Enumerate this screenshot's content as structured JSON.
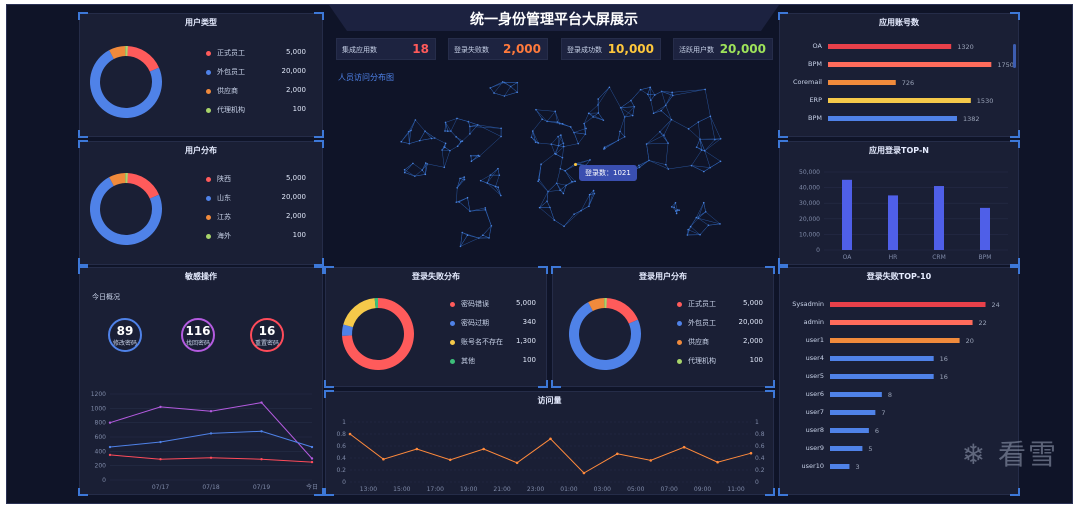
{
  "title": "统一身份管理平台大屏展示",
  "watermark": {
    "icon": "snowflake-icon",
    "text": "看雪"
  },
  "stats": [
    {
      "label": "集成应用数",
      "value": "18",
      "color": "#ff5a5a"
    },
    {
      "label": "登录失败数",
      "value": "2,000",
      "color": "#ff7a3c"
    },
    {
      "label": "登录成功数",
      "value": "10,000",
      "color": "#ffc83c"
    },
    {
      "label": "活跃用户数",
      "value": "20,000",
      "color": "#9ee35a"
    }
  ],
  "map": {
    "label": "人员访问分布图",
    "tooltip": "登录数：1021"
  },
  "user_type": {
    "title": "用户类型",
    "items": [
      {
        "name": "正式员工",
        "value": 5000,
        "value_text": "5,000",
        "color": "#ff5b5b"
      },
      {
        "name": "外包员工",
        "value": 20000,
        "value_text": "20,000",
        "color": "#4f82e8"
      },
      {
        "name": "供应商",
        "value": 2000,
        "value_text": "2,000",
        "color": "#f08a3c"
      },
      {
        "name": "代理机构",
        "value": 100,
        "value_text": "100",
        "color": "#a8d46a"
      }
    ]
  },
  "user_dist": {
    "title": "用户分布",
    "items": [
      {
        "name": "陕西",
        "value": 5000,
        "value_text": "5,000",
        "color": "#ff5b5b"
      },
      {
        "name": "山东",
        "value": 20000,
        "value_text": "20,000",
        "color": "#4f82e8"
      },
      {
        "name": "江苏",
        "value": 2000,
        "value_text": "2,000",
        "color": "#f08a3c"
      },
      {
        "name": "海外",
        "value": 100,
        "value_text": "100",
        "color": "#a8d46a"
      }
    ]
  },
  "sensitive": {
    "title": "敏感操作",
    "subtitle": "今日概况",
    "circles": [
      {
        "value": "89",
        "label": "修改密码",
        "color": "#4f82e8"
      },
      {
        "value": "116",
        "label": "找回密码",
        "color": "#b45be0"
      },
      {
        "value": "16",
        "label": "重置密码",
        "color": "#ff4b5a"
      }
    ]
  },
  "login_fail_dist": {
    "title": "登录失败分布",
    "items": [
      {
        "name": "密码错误",
        "value": 5000,
        "value_text": "5,000",
        "color": "#ff5b5b"
      },
      {
        "name": "密码过期",
        "value": 340,
        "value_text": "340",
        "color": "#4f82e8"
      },
      {
        "name": "账号名不存在",
        "value": 1300,
        "value_text": "1,300",
        "color": "#f5c94a"
      },
      {
        "name": "其他",
        "value": 100,
        "value_text": "100",
        "color": "#3dbf7a"
      }
    ]
  },
  "login_user_dist": {
    "title": "登录用户分布",
    "items": [
      {
        "name": "正式员工",
        "value": 5000,
        "value_text": "5,000",
        "color": "#ff5b5b"
      },
      {
        "name": "外包员工",
        "value": 20000,
        "value_text": "20,000",
        "color": "#4f82e8"
      },
      {
        "name": "供应商",
        "value": 2000,
        "value_text": "2,000",
        "color": "#f08a3c"
      },
      {
        "name": "代理机构",
        "value": 100,
        "value_text": "100",
        "color": "#a8d46a"
      }
    ]
  },
  "visits_title": "访问量",
  "app_accounts_title": "应用账号数",
  "app_login_title": "应用登录TOP-N",
  "login_fail_top_title": "登录失败TOP-10",
  "chart_data": [
    {
      "type": "line",
      "categories": [
        "07/17",
        "07/18",
        "07/19",
        "今日"
      ],
      "ylim": [
        0,
        1200
      ],
      "yticks": [
        "1200",
        "1000",
        "800",
        "600",
        "400",
        "200",
        "0"
      ],
      "series": [
        {
          "color": "#b45be0",
          "values": [
            800,
            1020,
            960,
            1080,
            300
          ]
        },
        {
          "color": "#4f82e8",
          "values": [
            460,
            530,
            650,
            680,
            460
          ]
        },
        {
          "color": "#ff4b5a",
          "values": [
            350,
            290,
            310,
            290,
            250
          ]
        }
      ]
    },
    {
      "type": "line",
      "categories": [
        "13:00",
        "15:00",
        "17:00",
        "19:00",
        "21:00",
        "23:00",
        "01:00",
        "03:00",
        "05:00",
        "07:00",
        "09:00",
        "11:00"
      ],
      "ylim": [
        0,
        1
      ],
      "yticks": [
        "1",
        "0.8",
        "0.6",
        "0.4",
        "0.2",
        "0"
      ],
      "series": [
        {
          "color": "#ff8a3c",
          "values": [
            0.8,
            0.38,
            0.55,
            0.37,
            0.55,
            0.32,
            0.72,
            0.15,
            0.47,
            0.36,
            0.58,
            0.33,
            0.48
          ]
        }
      ]
    },
    {
      "type": "bar",
      "orientation": "horizontal",
      "categories": [
        "OA",
        "BPM",
        "Coremail",
        "ERP",
        "BPM"
      ],
      "values": [
        1320,
        1750,
        726,
        1530,
        1382
      ],
      "value_labels": [
        "1320",
        "1750",
        "726",
        "1530",
        "1382"
      ],
      "colors": [
        "#e8404a",
        "#ff6b5b",
        "#f08a3c",
        "#f5c94a",
        "#4f82e8"
      ],
      "xlim": [
        0,
        1800
      ]
    },
    {
      "type": "bar",
      "categories": [
        "OA",
        "HR",
        "CRM",
        "BPM"
      ],
      "values": [
        45000,
        35000,
        41000,
        27000
      ],
      "ylim": [
        0,
        50000
      ],
      "yticks": [
        "50,000",
        "40,000",
        "30,000",
        "20,000",
        "10,000",
        "0"
      ],
      "color": "#4f5fe8"
    },
    {
      "type": "bar",
      "orientation": "horizontal",
      "categories": [
        "Sysadmin",
        "admin",
        "user1",
        "user4",
        "user5",
        "user6",
        "user7",
        "user8",
        "user9",
        "user10"
      ],
      "values": [
        24,
        22,
        20,
        16,
        16,
        8,
        7,
        6,
        5,
        3
      ],
      "value_labels": [
        "24",
        "22",
        "20",
        "16",
        "16",
        "8",
        "7",
        "6",
        "5",
        "3"
      ],
      "colors": [
        "#e8404a",
        "#ff6b5b",
        "#f08a3c",
        "#4f82e8",
        "#4f82e8",
        "#4f82e8",
        "#4f82e8",
        "#4f82e8",
        "#4f82e8",
        "#4f82e8"
      ],
      "xlim": [
        0,
        25
      ]
    }
  ]
}
